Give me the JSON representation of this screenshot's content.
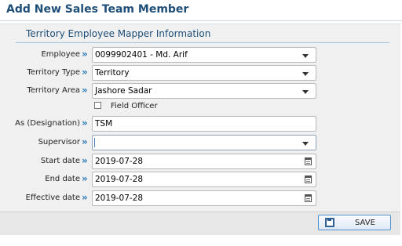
{
  "page": {
    "title": "Add New Sales Team Member"
  },
  "section": {
    "title": "Territory Employee Mapper Information"
  },
  "form": {
    "employee": {
      "label": "Employee",
      "value": "0099902401 - Md. Arif"
    },
    "territory_type": {
      "label": "Territory Type",
      "value": "Territory"
    },
    "territory_area": {
      "label": "Territory Area",
      "value": "Jashore Sadar"
    },
    "field_officer": {
      "label": "Field Officer",
      "checked": false
    },
    "designation": {
      "label": "As (Designation)",
      "value": "TSM"
    },
    "supervisor": {
      "label": "Supervisor",
      "value": ""
    },
    "start_date": {
      "label": "Start date",
      "value": "2019-07-28"
    },
    "end_date": {
      "label": "End date",
      "value": "2019-07-28"
    },
    "effective_date": {
      "label": "Effective date",
      "value": "2019-07-28"
    }
  },
  "icons": {
    "label_marker": "double-chevron-right",
    "dropdown": "caret-down",
    "date": "calendar",
    "save": "floppy-disk"
  },
  "footer": {
    "save_label": "SAVE"
  },
  "colors": {
    "title": "#1e4e78",
    "accent": "#2f79b8",
    "panel": "#f0f0f0"
  }
}
